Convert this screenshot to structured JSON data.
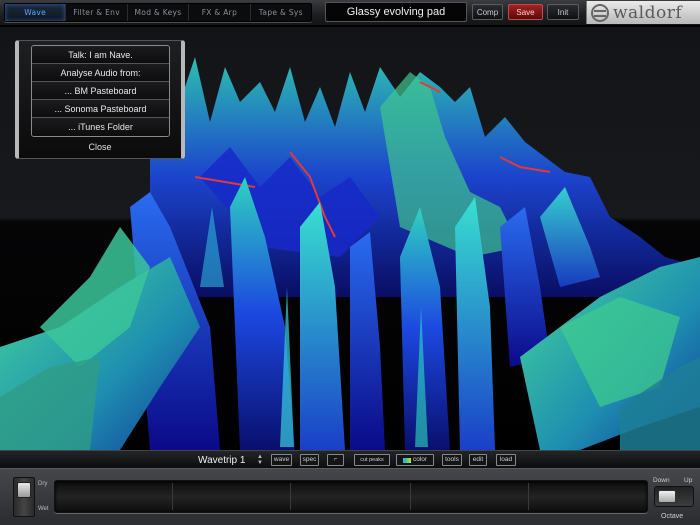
{
  "tabs": [
    {
      "label": "Wave",
      "active": true
    },
    {
      "label": "Filter & Env",
      "active": false
    },
    {
      "label": "Mod & Keys",
      "active": false
    },
    {
      "label": "FX & Arp",
      "active": false
    },
    {
      "label": "Tape & Sys",
      "active": false
    }
  ],
  "patch_name": "Glassy evolving pad",
  "buttons": {
    "compare": "Comp",
    "save": "Save",
    "init": "Init"
  },
  "brand": "waldorf",
  "menu": {
    "items": [
      "Talk: I am Nave.",
      "Analyse Audio from:",
      "... BM Pasteboard",
      "... Sonoma Pasteboard",
      "... iTunes Folder"
    ],
    "close": "Close"
  },
  "bottom_toolbar": {
    "wavetrip_name": "Wavetrip 1",
    "wave": "wave",
    "spec": "spec",
    "cut_peaks": "cut peaks",
    "color": "color",
    "tools": "tools",
    "edit": "edit",
    "load": "load"
  },
  "drywet": {
    "dry": "Dry",
    "wet": "Wet"
  },
  "octave": {
    "down": "Down",
    "up": "Up",
    "label": "Octave"
  },
  "colors": {
    "accent": "#5aa7ff",
    "save": "#a22222",
    "wave_blue": "#1a2bd8",
    "wave_green": "#3fc48a"
  }
}
